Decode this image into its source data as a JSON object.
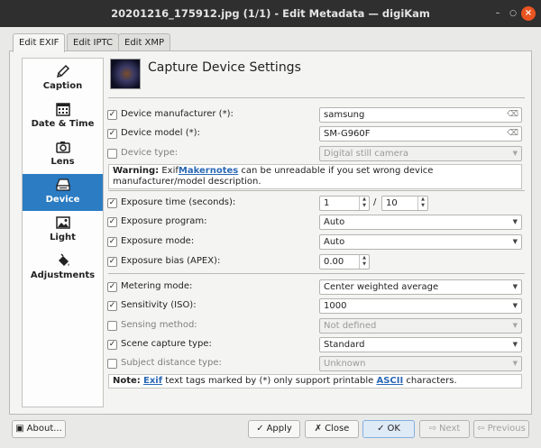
{
  "window": {
    "title": "20201216_175912.jpg (1/1) - Edit Metadata — digiKam"
  },
  "tabs": [
    {
      "label": "Edit EXIF",
      "active": true
    },
    {
      "label": "Edit IPTC",
      "active": false
    },
    {
      "label": "Edit XMP",
      "active": false
    }
  ],
  "sidebar": {
    "items": [
      {
        "label": "Caption",
        "icon": "pencil-icon"
      },
      {
        "label": "Date & Time",
        "icon": "calendar-icon"
      },
      {
        "label": "Lens",
        "icon": "camera-icon"
      },
      {
        "label": "Device",
        "icon": "scanner-icon",
        "selected": true
      },
      {
        "label": "Light",
        "icon": "image-icon"
      },
      {
        "label": "Adjustments",
        "icon": "paint-bucket-icon"
      }
    ]
  },
  "header": {
    "title": "Capture Device Settings"
  },
  "fields": {
    "manufacturer": {
      "label": "Device manufacturer (*):",
      "value": "samsung",
      "checked": true
    },
    "model": {
      "label": "Device model (*):",
      "value": "SM-G960F",
      "checked": true
    },
    "type": {
      "label": "Device type:",
      "value": "Digital still camera",
      "checked": false
    },
    "exposure_time": {
      "label": "Exposure time (seconds):",
      "num": "1",
      "sep": "/",
      "den": "10",
      "checked": true
    },
    "exposure_program": {
      "label": "Exposure program:",
      "value": "Auto",
      "checked": true
    },
    "exposure_mode": {
      "label": "Exposure mode:",
      "value": "Auto",
      "checked": true
    },
    "exposure_bias": {
      "label": "Exposure bias (APEX):",
      "value": "0.00",
      "checked": true
    },
    "metering_mode": {
      "label": "Metering mode:",
      "value": "Center weighted average",
      "checked": true
    },
    "sensitivity": {
      "label": "Sensitivity (ISO):",
      "value": "1000",
      "checked": true
    },
    "sensing_method": {
      "label": "Sensing method:",
      "value": "Not defined",
      "checked": false
    },
    "scene_capture": {
      "label": "Scene capture type:",
      "value": "Standard",
      "checked": true
    },
    "subject_distance": {
      "label": "Subject distance type:",
      "value": "Unknown",
      "checked": false
    }
  },
  "warning": {
    "prefix": "Warning:",
    "t1": " Exif",
    "link": "Makernotes",
    "t2": " can be unreadable if you set wrong device manufacturer/model description."
  },
  "note": {
    "prefix": "Note:",
    "link1": "Exif",
    "t1": " text tags marked by (*) only support printable ",
    "link2": "ASCII",
    "t2": " characters."
  },
  "footer": {
    "about": "About...",
    "apply": "Apply",
    "close": "Close",
    "ok": "OK",
    "next": "Next",
    "previous": "Previous"
  }
}
